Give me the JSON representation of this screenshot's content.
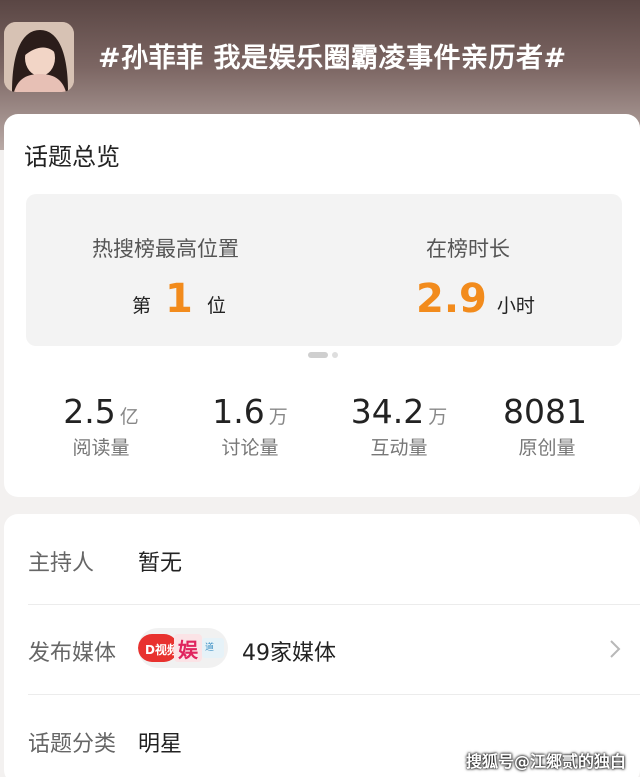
{
  "header": {
    "title": "#孙菲菲 我是娱乐圈霸凌事件亲历者#",
    "avatar_icon": "avatar-photo"
  },
  "overview": {
    "title": "话题总览",
    "hot_rank": {
      "label": "热搜榜最高位置",
      "prefix": "第",
      "value": "1",
      "suffix": "位"
    },
    "on_list_duration": {
      "label": "在榜时长",
      "value": "2.9",
      "unit": "小时"
    },
    "stats": [
      {
        "value": "2.5",
        "unit": "亿",
        "label": "阅读量"
      },
      {
        "value": "1.6",
        "unit": "万",
        "label": "讨论量"
      },
      {
        "value": "34.2",
        "unit": "万",
        "label": "互动量"
      },
      {
        "value": "8081",
        "unit": "",
        "label": "原创量"
      }
    ]
  },
  "details": {
    "host": {
      "label": "主持人",
      "value": "暂无"
    },
    "media": {
      "label": "发布媒体",
      "value": "49家媒体",
      "logo_icon": "media-logos"
    },
    "category": {
      "label": "话题分类",
      "value": "明星"
    }
  },
  "watermark": "搜狐号@江郷贰的独白",
  "colors": {
    "accent": "#f28b1c"
  }
}
